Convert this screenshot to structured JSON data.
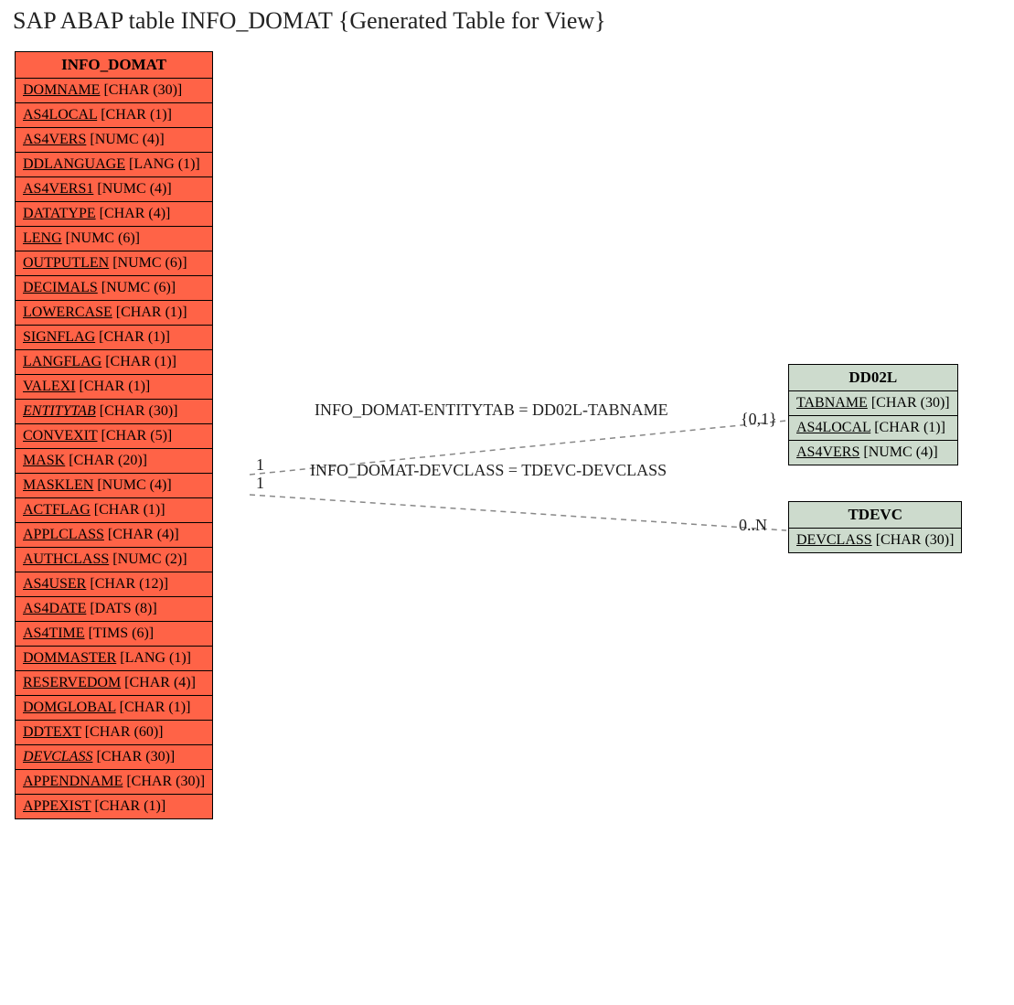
{
  "title": "SAP ABAP table INFO_DOMAT {Generated Table for View}",
  "main_entity": {
    "name": "INFO_DOMAT",
    "fields": [
      {
        "name": "DOMNAME",
        "type": "[CHAR (30)]",
        "italic": false
      },
      {
        "name": "AS4LOCAL",
        "type": "[CHAR (1)]",
        "italic": false
      },
      {
        "name": "AS4VERS",
        "type": "[NUMC (4)]",
        "italic": false
      },
      {
        "name": "DDLANGUAGE",
        "type": "[LANG (1)]",
        "italic": false
      },
      {
        "name": "AS4VERS1",
        "type": "[NUMC (4)]",
        "italic": false
      },
      {
        "name": "DATATYPE",
        "type": "[CHAR (4)]",
        "italic": false
      },
      {
        "name": "LENG",
        "type": "[NUMC (6)]",
        "italic": false
      },
      {
        "name": "OUTPUTLEN",
        "type": "[NUMC (6)]",
        "italic": false
      },
      {
        "name": "DECIMALS",
        "type": "[NUMC (6)]",
        "italic": false
      },
      {
        "name": "LOWERCASE",
        "type": "[CHAR (1)]",
        "italic": false
      },
      {
        "name": "SIGNFLAG",
        "type": "[CHAR (1)]",
        "italic": false
      },
      {
        "name": "LANGFLAG",
        "type": "[CHAR (1)]",
        "italic": false
      },
      {
        "name": "VALEXI",
        "type": "[CHAR (1)]",
        "italic": false
      },
      {
        "name": "ENTITYTAB",
        "type": "[CHAR (30)]",
        "italic": true
      },
      {
        "name": "CONVEXIT",
        "type": "[CHAR (5)]",
        "italic": false
      },
      {
        "name": "MASK",
        "type": "[CHAR (20)]",
        "italic": false
      },
      {
        "name": "MASKLEN",
        "type": "[NUMC (4)]",
        "italic": false
      },
      {
        "name": "ACTFLAG",
        "type": "[CHAR (1)]",
        "italic": false
      },
      {
        "name": "APPLCLASS",
        "type": "[CHAR (4)]",
        "italic": false
      },
      {
        "name": "AUTHCLASS",
        "type": "[NUMC (2)]",
        "italic": false
      },
      {
        "name": "AS4USER",
        "type": "[CHAR (12)]",
        "italic": false
      },
      {
        "name": "AS4DATE",
        "type": "[DATS (8)]",
        "italic": false
      },
      {
        "name": "AS4TIME",
        "type": "[TIMS (6)]",
        "italic": false
      },
      {
        "name": "DOMMASTER",
        "type": "[LANG (1)]",
        "italic": false
      },
      {
        "name": "RESERVEDOM",
        "type": "[CHAR (4)]",
        "italic": false
      },
      {
        "name": "DOMGLOBAL",
        "type": "[CHAR (1)]",
        "italic": false
      },
      {
        "name": "DDTEXT",
        "type": "[CHAR (60)]",
        "italic": false
      },
      {
        "name": "DEVCLASS",
        "type": "[CHAR (30)]",
        "italic": true
      },
      {
        "name": "APPENDNAME",
        "type": "[CHAR (30)]",
        "italic": false
      },
      {
        "name": "APPEXIST",
        "type": "[CHAR (1)]",
        "italic": false
      }
    ]
  },
  "related_entities": [
    {
      "name": "DD02L",
      "fields": [
        {
          "name": "TABNAME",
          "type": "[CHAR (30)]"
        },
        {
          "name": "AS4LOCAL",
          "type": "[CHAR (1)]"
        },
        {
          "name": "AS4VERS",
          "type": "[NUMC (4)]"
        }
      ]
    },
    {
      "name": "TDEVC",
      "fields": [
        {
          "name": "DEVCLASS",
          "type": "[CHAR (30)]"
        }
      ]
    }
  ],
  "relationships": [
    {
      "label": "INFO_DOMAT-ENTITYTAB = DD02L-TABNAME",
      "left_card": "1",
      "right_card": "{0,1}"
    },
    {
      "label": "INFO_DOMAT-DEVCLASS = TDEVC-DEVCLASS",
      "left_card": "1",
      "right_card": "0..N"
    }
  ]
}
